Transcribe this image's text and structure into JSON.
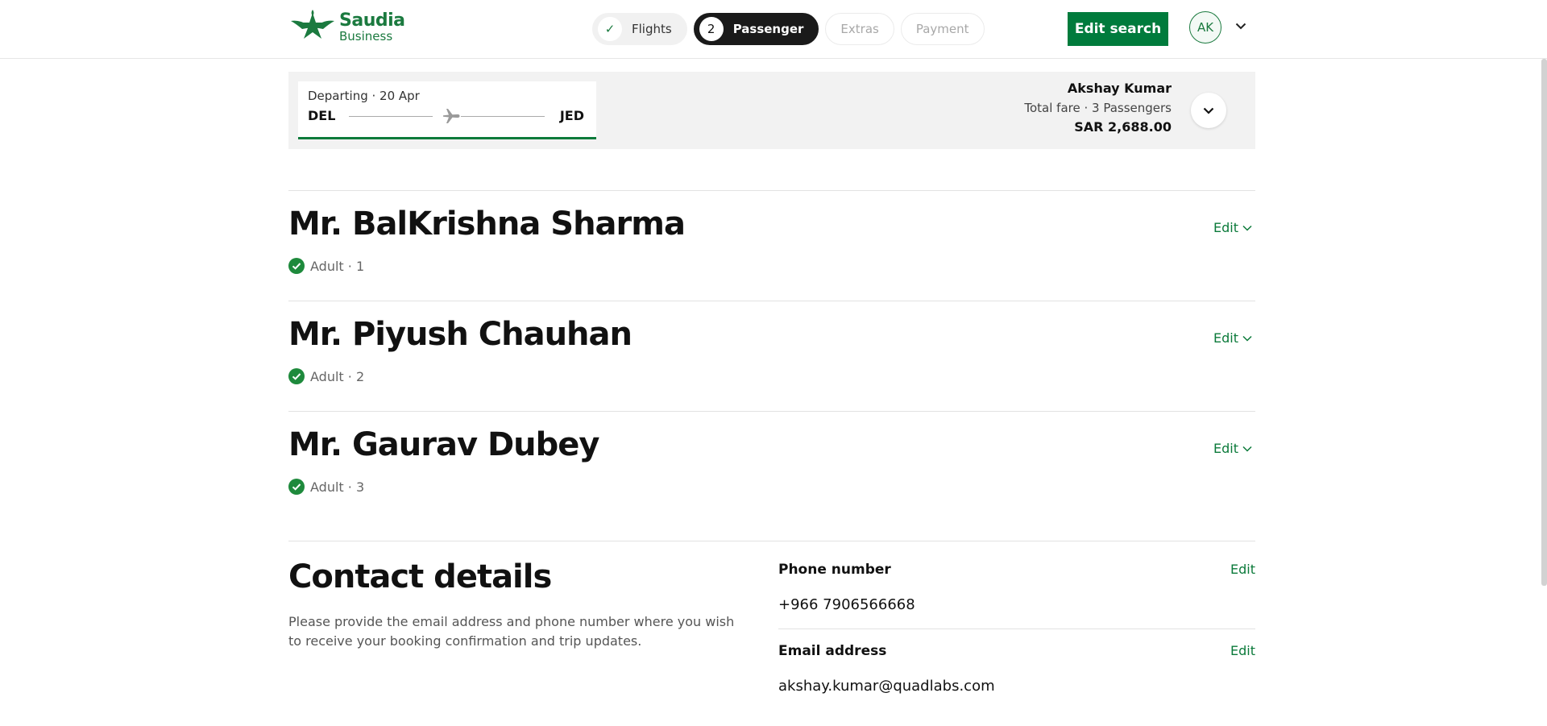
{
  "brand": {
    "name_line1": "Saudia",
    "name_line2": "Business",
    "color": "#1b7a3f"
  },
  "stepper": {
    "steps": [
      {
        "label": "Flights",
        "state": "done",
        "marker": "✓"
      },
      {
        "label": "Passenger",
        "state": "active",
        "marker": "2"
      },
      {
        "label": "Extras",
        "state": "todo"
      },
      {
        "label": "Payment",
        "state": "todo"
      }
    ]
  },
  "header": {
    "edit_search_label": "Edit search",
    "avatar_initials": "AK"
  },
  "summary": {
    "departing": "Departing · 20 Apr",
    "from": "DEL",
    "to": "JED",
    "user_name": "Akshay Kumar",
    "fare_label": "Total fare · 3 Passengers",
    "total": "SAR 2,688.00"
  },
  "passengers": [
    {
      "name": "Mr. BalKrishna Sharma",
      "meta": "Adult · 1",
      "edit_label": "Edit"
    },
    {
      "name": "Mr. Piyush Chauhan",
      "meta": "Adult · 2",
      "edit_label": "Edit"
    },
    {
      "name": "Mr. Gaurav Dubey",
      "meta": "Adult · 3",
      "edit_label": "Edit"
    }
  ],
  "contact": {
    "title": "Contact details",
    "description": "Please provide the email address and phone number where you wish to receive your booking confirmation and trip updates.",
    "phone_label": "Phone number",
    "phone_value": "+966 7906566668",
    "phone_edit": "Edit",
    "email_label": "Email address",
    "email_value": "akshay.kumar@quadlabs.com",
    "email_edit": "Edit"
  },
  "colors": {
    "accent": "#007b3c",
    "active_step": "#1a1a1a",
    "summary_bg": "#f2f2f2"
  }
}
